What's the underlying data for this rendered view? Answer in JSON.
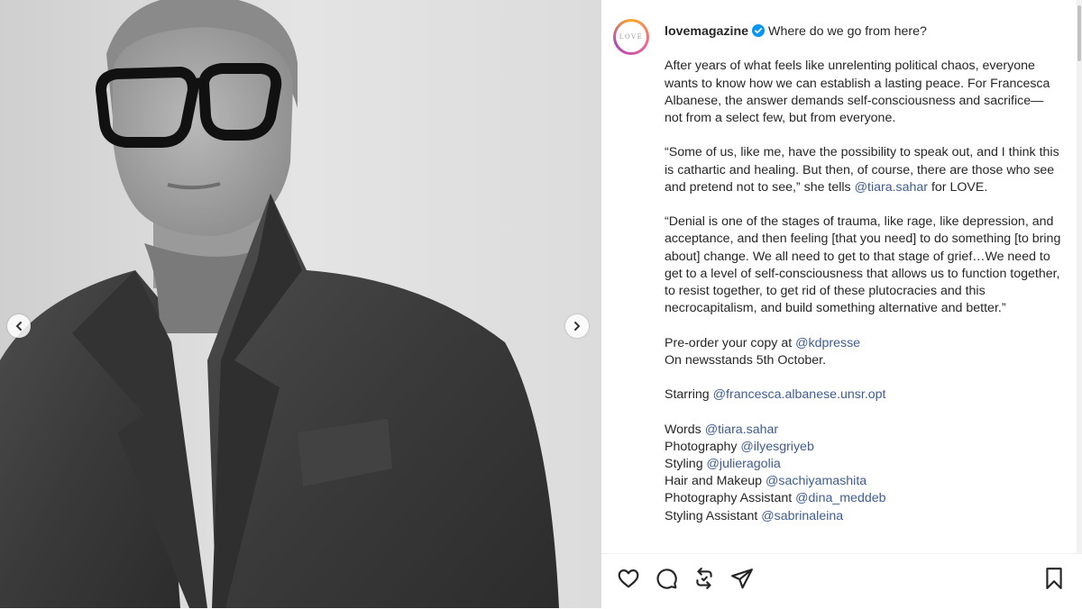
{
  "post": {
    "username": "lovemagazine",
    "avatar_text": "LOVE",
    "title": "Where do we go from here?",
    "paragraph_1": "After years of what feels like unrelenting political chaos, everyone wants to know how we can establish a lasting peace. For Francesca Albanese, the answer demands self-consciousness and sacrifice—not from a select few, but from everyone.",
    "paragraph_2_before": "“Some of us, like me, have the possibility to speak out, and I think this is cathartic and healing. But then, of course, there are those who see and pretend not to see,” she tells ",
    "paragraph_2_mention": "@tiara.sahar",
    "paragraph_2_after": " for LOVE.",
    "paragraph_3": "“Denial is one of the stages of trauma, like rage, like depression, and acceptance, and then feeling [that you need] to do something [to bring about] change. We all need to get to that stage of grief…We need to get to a level of self-consciousness that allows us to function together, to resist together, to get rid of these plutocracies and this necrocapitalism, and build something alternative and better.”",
    "preorder_label": "Pre-order your copy at ",
    "preorder_mention": "@kdpresse",
    "newsstands": "On newsstands 5th October.",
    "starring_label": "Starring ",
    "starring_mention": "@francesca.albanese.unsr.opt",
    "credits": [
      {
        "label": "Words ",
        "mention": "@tiara.sahar"
      },
      {
        "label": "Photography ",
        "mention": "@ilyesgriyeb"
      },
      {
        "label": "Styling ",
        "mention": "@julieragolia"
      },
      {
        "label": "Hair and Makeup ",
        "mention": "@sachiyamashita"
      },
      {
        "label": "Photography Assistant ",
        "mention": "@dina_meddeb"
      },
      {
        "label": "Styling Assistant ",
        "mention": "@sabrinaleina"
      }
    ]
  },
  "colors": {
    "mention": "#405c8f",
    "verified": "#0095f6",
    "text": "#262626"
  },
  "icons": {
    "verified": "verified-badge-icon",
    "prev": "chevron-left-icon",
    "next": "chevron-right-icon",
    "like": "heart-icon",
    "comment": "comment-icon",
    "share_repost": "repost-icon",
    "send": "send-icon",
    "save": "bookmark-icon"
  }
}
